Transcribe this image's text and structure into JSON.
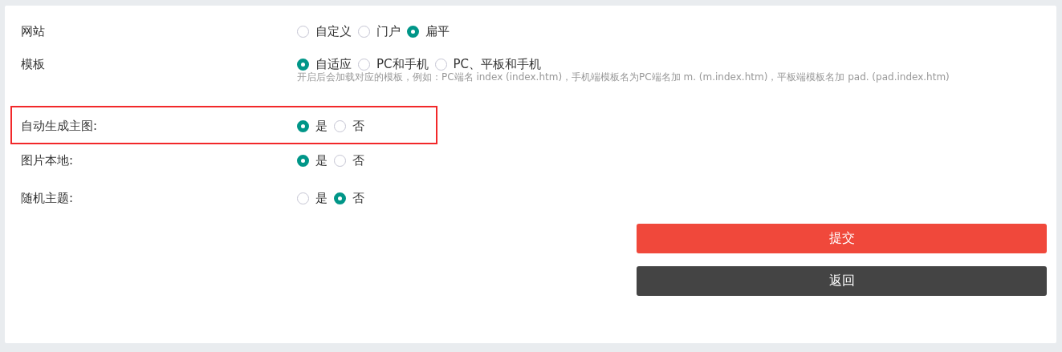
{
  "settings": [
    {
      "label": "网站",
      "highlighted": false,
      "options": [
        {
          "label": "自定义",
          "selected": false
        },
        {
          "label": "门户",
          "selected": false
        },
        {
          "label": "扁平",
          "selected": true
        }
      ]
    },
    {
      "label": "模板",
      "highlighted": false,
      "options": [
        {
          "label": "自适应",
          "selected": true
        },
        {
          "label": "PC和手机",
          "selected": false
        },
        {
          "label": "PC、平板和手机",
          "selected": false
        }
      ],
      "help": "开启后会加载对应的模板，例如：PC端名 index (index.htm)，手机端模板名为PC端名加 m. (m.index.htm)，平板端模板名加 pad. (pad.index.htm)"
    },
    {
      "label": "自动生成主图:",
      "highlighted": true,
      "options": [
        {
          "label": "是",
          "selected": true
        },
        {
          "label": "否",
          "selected": false
        }
      ]
    },
    {
      "label": "图片本地:",
      "highlighted": false,
      "options": [
        {
          "label": "是",
          "selected": true
        },
        {
          "label": "否",
          "selected": false
        }
      ]
    },
    {
      "label": "随机主题:",
      "highlighted": false,
      "options": [
        {
          "label": "是",
          "selected": false
        },
        {
          "label": "否",
          "selected": true
        }
      ]
    }
  ],
  "buttons": [
    {
      "label": "提交",
      "kind": "primary"
    },
    {
      "label": "返回",
      "kind": "secondary"
    }
  ]
}
